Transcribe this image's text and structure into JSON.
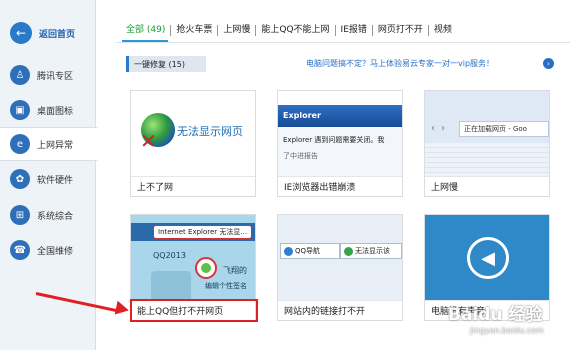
{
  "sidebar": {
    "back_label": "返回首页",
    "items": [
      {
        "label": "腾讯专区",
        "icon": "qq-penguin-icon",
        "glyph": "♙"
      },
      {
        "label": "桌面图标",
        "icon": "monitor-icon",
        "glyph": "▣"
      },
      {
        "label": "上网异常",
        "icon": "internet-explorer-icon",
        "glyph": "e"
      },
      {
        "label": "软件硬件",
        "icon": "gear-icon",
        "glyph": "✿"
      },
      {
        "label": "系统综合",
        "icon": "windows-icon",
        "glyph": "⊞"
      },
      {
        "label": "全国维修",
        "icon": "phone-icon",
        "glyph": "☎"
      }
    ]
  },
  "tabs": [
    "全部 (49)",
    "抢火车票",
    "上网慢",
    "能上QQ不能上网",
    "IE报错",
    "网页打不开",
    "视频"
  ],
  "subheader": "一键修复 (15)",
  "promo": "电脑问题搞不定？马上体验易云专家一对一vip服务！",
  "cards": [
    {
      "title": "上不了网",
      "art": "无法显示网页"
    },
    {
      "title": "IE浏览器出错崩溃",
      "art_title": "Explorer",
      "art_line": "Explorer 遇到问题需要关闭。我",
      "art_line2": "了中进报告"
    },
    {
      "title": "上网慢",
      "art": "正在加载网页 - Goo"
    },
    {
      "title": "能上QQ但打不开网页",
      "art_pill": "Internet Explorer 无法显...",
      "art_label": "QQ2013",
      "art_fly": "飞翔的",
      "art_sig": "编辑个性签名"
    },
    {
      "title": "网站内的链接打不开",
      "art_tab1": "QQ导航",
      "art_tab2": "无法显示该"
    },
    {
      "title": "电脑没有声音",
      "art": "sound-off-icon"
    }
  ],
  "watermark": "Baidu 经验",
  "watermark_sub": "jingyan.baidu.com"
}
